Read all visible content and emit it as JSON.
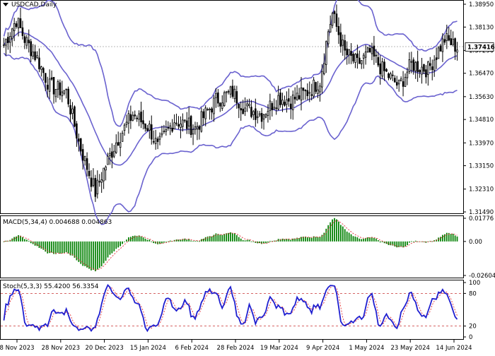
{
  "chart_data": [
    {
      "type": "candlestick",
      "symbol": "USDCAD",
      "timeframe": "Daily",
      "title": "USDCAD,Daily",
      "current_price": "1.37416",
      "ylim": [
        1.3149,
        1.3895
      ],
      "y_ticks": [
        "1.38950",
        "1.38130",
        "1.37290",
        "1.36470",
        "1.35630",
        "1.34810",
        "1.33970",
        "1.33150",
        "1.32310",
        "1.31490"
      ],
      "x_ticks": [
        "8 Nov 2023",
        "28 Nov 2023",
        "20 Dec 2023",
        "15 Jan 2024",
        "6 Feb 2024",
        "28 Feb 2024",
        "19 Mar 2024",
        "9 Apr 2024",
        "1 May 2024",
        "23 May 2024",
        "14 Jun 2024"
      ],
      "close_anchors": [
        [
          0,
          1.375
        ],
        [
          6,
          1.384
        ],
        [
          10,
          1.377
        ],
        [
          16,
          1.37
        ],
        [
          22,
          1.36
        ],
        [
          30,
          1.358
        ],
        [
          36,
          1.34
        ],
        [
          44,
          1.322
        ],
        [
          48,
          1.33
        ],
        [
          54,
          1.34
        ],
        [
          62,
          1.35
        ],
        [
          70,
          1.345
        ],
        [
          74,
          1.338
        ],
        [
          82,
          1.348
        ],
        [
          92,
          1.345
        ],
        [
          102,
          1.355
        ],
        [
          110,
          1.358
        ],
        [
          116,
          1.352
        ],
        [
          124,
          1.35
        ],
        [
          132,
          1.356
        ],
        [
          138,
          1.355
        ],
        [
          146,
          1.358
        ],
        [
          152,
          1.362
        ],
        [
          156,
          1.38
        ],
        [
          158,
          1.386
        ],
        [
          164,
          1.372
        ],
        [
          170,
          1.368
        ],
        [
          176,
          1.372
        ],
        [
          182,
          1.366
        ],
        [
          190,
          1.36
        ],
        [
          196,
          1.368
        ],
        [
          204,
          1.366
        ],
        [
          212,
          1.377
        ],
        [
          218,
          1.374
        ]
      ],
      "bollinger": {
        "period": 20,
        "deviation": 2,
        "color": "#6a62cf"
      },
      "up_color": "#000000",
      "down_color": "#000000"
    },
    {
      "type": "histogram",
      "name": "MACD(5,34,4)",
      "title": "MACD(5,34,4) 0.004688 0.004863",
      "values_text": [
        "0.004688",
        "0.004863"
      ],
      "ylim": [
        -0.026047,
        0.01776
      ],
      "y_ticks": [
        "0.01776",
        "0.00",
        "-0.026047"
      ],
      "bar_color": "#008000",
      "signal_color": "#e0303a"
    },
    {
      "type": "line",
      "name": "Stoch(5,3,3)",
      "title": "Stoch(5,3,3) 55.4200 56.3354",
      "values_text": [
        "55.4200",
        "56.3354"
      ],
      "ylim": [
        0,
        100
      ],
      "y_ticks": [
        "100",
        "80",
        "20",
        "0"
      ],
      "levels": [
        80,
        20
      ],
      "main_color": "#1f1fd0",
      "signal_color": "#e0303a",
      "level_color": "#c83030"
    }
  ]
}
